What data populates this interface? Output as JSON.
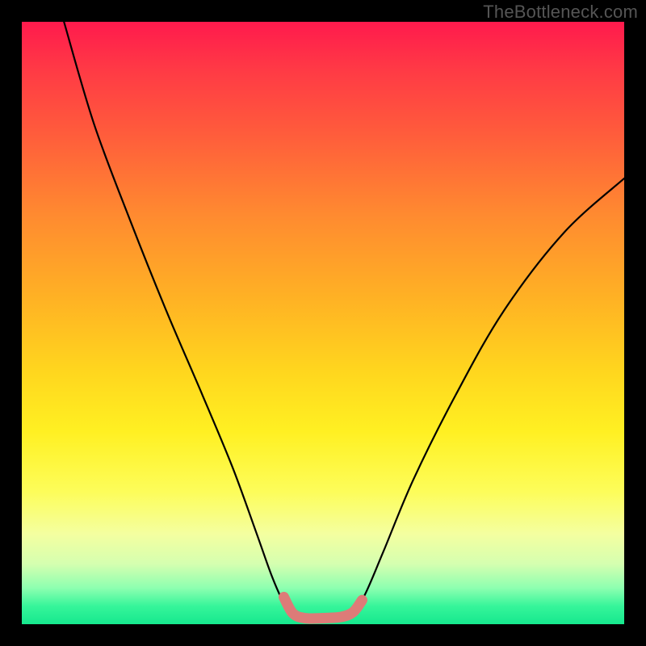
{
  "watermark": "TheBottleneck.com",
  "chart_data": {
    "type": "line",
    "title": "",
    "xlabel": "",
    "ylabel": "",
    "xlim": [
      0,
      100
    ],
    "ylim": [
      0,
      100
    ],
    "series": [
      {
        "name": "curve",
        "x": [
          7,
          12,
          18,
          24,
          30,
          35,
          39,
          41.5,
          43.5,
          45,
          47,
          50,
          53,
          55,
          57,
          60,
          65,
          72,
          80,
          90,
          100
        ],
        "y": [
          100,
          83,
          67,
          52,
          38,
          26,
          15,
          8,
          3.5,
          1.5,
          0.8,
          0.8,
          1.0,
          2.0,
          5,
          12,
          24,
          38,
          52,
          65,
          74
        ]
      }
    ],
    "highlight": {
      "name": "trough-marker",
      "color": "#dd7b78",
      "points": [
        {
          "x": 43.5,
          "y": 4.5
        },
        {
          "x": 45.0,
          "y": 1.8
        },
        {
          "x": 47.0,
          "y": 1.0
        },
        {
          "x": 50.0,
          "y": 1.0
        },
        {
          "x": 53.0,
          "y": 1.2
        },
        {
          "x": 55.0,
          "y": 2.0
        },
        {
          "x": 56.5,
          "y": 4.0
        }
      ]
    }
  }
}
